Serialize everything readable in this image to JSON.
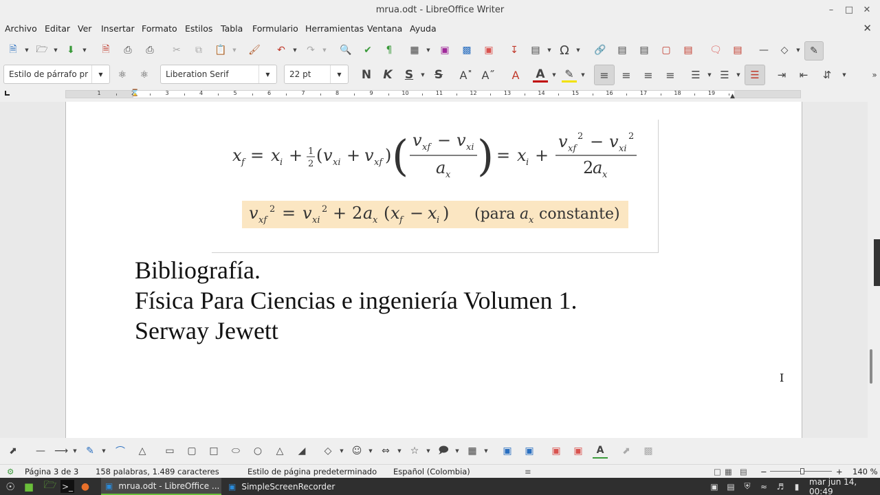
{
  "window": {
    "title": "mrua.odt - LibreOffice Writer"
  },
  "menu": [
    "Archivo",
    "Editar",
    "Ver",
    "Insertar",
    "Formato",
    "Estilos",
    "Tabla",
    "Formulario",
    "Herramientas",
    "Ventana",
    "Ayuda"
  ],
  "format_bar": {
    "paragraph_style": "Estilo de párrafo pr",
    "font_name": "Liberation Serif",
    "font_size": "22 pt",
    "bold": "N",
    "italic": "K",
    "underline": "S",
    "strike": "S"
  },
  "ruler": {
    "numbers": [
      "1",
      "2",
      "3",
      "4",
      "5",
      "6",
      "7",
      "8",
      "9",
      "10",
      "11",
      "12",
      "13",
      "14",
      "15",
      "16",
      "17",
      "18",
      "19"
    ]
  },
  "equations": {
    "eq1": "x_f = x_i + ½(v_xi + v_xf)((v_xf − v_xi)/a_x) = x_i + (v_xf² − v_xi²)/2a_x",
    "eq2_left": "v_xf² = v_xi² + 2a_x (x_f − x_i)",
    "eq2_note": "(para a_x constante)"
  },
  "document": {
    "lines": [
      "Bibliografía.",
      "Física Para Ciencias e ingeniería Volumen 1.",
      "Serway  Jewett"
    ]
  },
  "status": {
    "page": "Página 3 de 3",
    "words": "158 palabras, 1.489 caracteres",
    "page_style": "Estilo de página predeterminado",
    "language": "Español (Colombia)",
    "zoom": "140 %"
  },
  "taskbar": {
    "app1": "mrua.odt - LibreOffice ...",
    "app2": "SimpleScreenRecorder",
    "clock": "mar jun 14, 00:49"
  }
}
